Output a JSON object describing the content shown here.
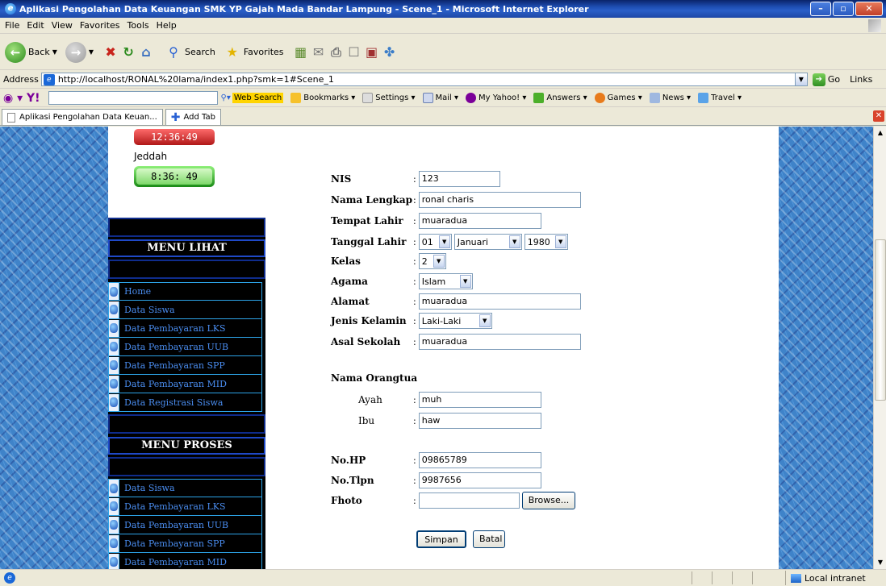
{
  "window": {
    "title": "Aplikasi Pengolahan Data Keuangan SMK YP Gajah Mada Bandar Lampung - Scene_1 - Microsoft Internet Explorer"
  },
  "menubar": [
    "File",
    "Edit",
    "View",
    "Favorites",
    "Tools",
    "Help"
  ],
  "toolbar": {
    "back": "Back",
    "search": "Search",
    "favorites": "Favorites"
  },
  "address": {
    "label": "Address",
    "url": "http://localhost/RONAL%20lama/index1.php?smk=1#Scene_1",
    "go": "Go",
    "links": "Links"
  },
  "yahoo": {
    "web_search": "Web Search",
    "bookmarks": "Bookmarks",
    "settings": "Settings",
    "mail": "Mail",
    "my_yahoo": "My Yahoo!",
    "answers": "Answers",
    "games": "Games",
    "news": "News",
    "travel": "Travel"
  },
  "tabs": {
    "active": "Aplikasi Pengolahan Data Keuan...",
    "add": "Add Tab"
  },
  "sidebar": {
    "clock_top": "12:36:49",
    "city": "Jeddah",
    "clock_city": "8:36: 49",
    "menu_lihat_title": "MENU LIHAT",
    "menu_lihat": [
      "Home",
      "Data Siswa",
      "Data Pembayaran LKS",
      "Data Pembayaran UUB",
      "Data Pembayaran SPP",
      "Data Pembayaran MID",
      "Data Registrasi Siswa"
    ],
    "menu_proses_title": "MENU PROSES",
    "menu_proses": [
      "Data Siswa",
      "Data Pembayaran LKS",
      "Data Pembayaran UUB",
      "Data Pembayaran SPP",
      "Data Pembayaran MID"
    ]
  },
  "form": {
    "nis_label": "NIS",
    "nis": "123",
    "nama_label": "Nama Lengkap",
    "nama": "ronal charis",
    "tempat_label": "Tempat Lahir",
    "tempat": "muaradua",
    "tanggal_label": "Tanggal Lahir",
    "tgl_day": "01",
    "tgl_month": "Januari",
    "tgl_year": "1980",
    "kelas_label": "Kelas",
    "kelas": "2",
    "agama_label": "Agama",
    "agama": "Islam",
    "alamat_label": "Alamat",
    "alamat": "muaradua",
    "jk_label": "Jenis Kelamin",
    "jk": "Laki-Laki",
    "asal_label": "Asal Sekolah",
    "asal": "muaradua",
    "ortu_label": "Nama Orangtua",
    "ayah_label": "Ayah",
    "ayah": "muh",
    "ibu_label": "Ibu",
    "ibu": "haw",
    "hp_label": "No.HP",
    "hp": "09865789",
    "tlpn_label": "No.Tlpn",
    "tlpn": "9987656",
    "foto_label": "Fhoto",
    "foto": "",
    "browse": "Browse...",
    "simpan": "Simpan",
    "batal": "Batal",
    "colon": ":"
  },
  "status": {
    "zone": "Local intranet"
  }
}
